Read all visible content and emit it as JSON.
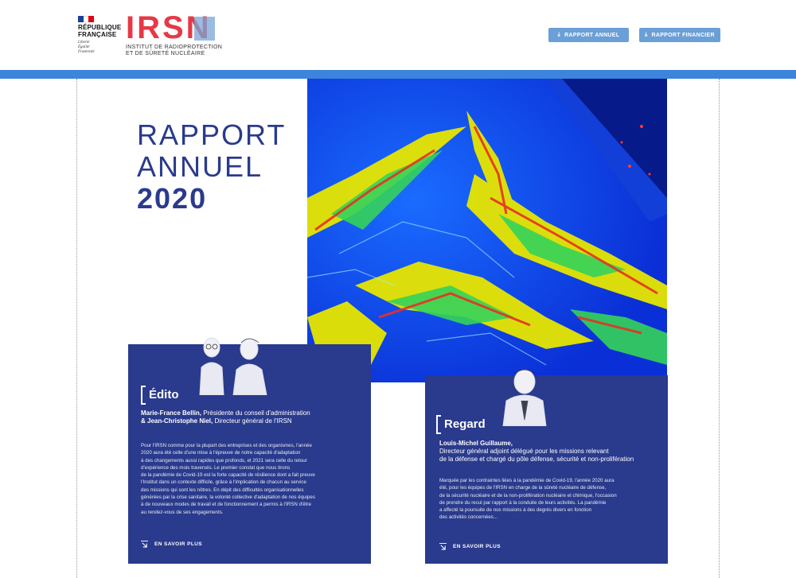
{
  "header": {
    "gov": {
      "line1": "RÉPUBLIQUE",
      "line2": "FRANÇAISE",
      "motto1": "Liberté",
      "motto2": "Égalité",
      "motto3": "Fraternité"
    },
    "logo": {
      "word": "IRSN",
      "sub1": "INSTITUT DE RADIOPROTECTION",
      "sub2": "ET DE SÛRETÉ NUCLÉAIRE"
    },
    "buttons": [
      {
        "label": "RAPPORT ANNUEL",
        "icon": "download-icon"
      },
      {
        "label": "RAPPORT FINANCIER",
        "icon": "download-icon"
      }
    ]
  },
  "colors": {
    "brand_blue": "#2a3a8c",
    "band_blue": "#3c84dc",
    "button_blue": "#6a9fd8",
    "logo_red": "#e63946"
  },
  "title": {
    "line1": "RAPPORT",
    "line2": "ANNUEL",
    "line3": "2020"
  },
  "edito": {
    "heading": "Édito",
    "author1_name": "Marie-France Bellin,",
    "author1_role": " Présidente du conseil d'administration",
    "author2_name": "& Jean-Christophe Niel,",
    "author2_role": " Directeur général de l'IRSN",
    "body": [
      "Pour l'IRSN comme pour la plupart des entreprises et des organismes, l'année",
      "2020 aura été celle d'une mise à l'épreuve de notre capacité d'adaptation",
      "à des changements aussi rapides que profonds, et 2021 sera celle du retour",
      "d'expérience des mois traversés. Le premier constat que nous tirons",
      "de la pandémie de Covid-19 est la forte capacité de résilience dont a fait preuve",
      "l'Institut dans un contexte difficile, grâce à l'implication de chacun au service",
      "des missions qui sont les nôtres. En dépit des difficultés organisationnelles",
      "générées par la crise sanitaire, la volonté collective d'adaptation de nos équipes",
      "à de nouveaux modes de travail et de fonctionnement a permis à l'IRSN d'être",
      "au rendez-vous de ses engagements."
    ],
    "link": "EN SAVOIR PLUS"
  },
  "regard": {
    "heading": "Regard",
    "author_name": "Louis-Michel Guillaume,",
    "author_role_line1": "Directeur général adjoint délégué pour les missions relevant",
    "author_role_line2": "de la défense et chargé du pôle défense, sécurité et non-prolifération",
    "body": [
      "Marquée par les contraintes liées à la pandémie de Covid-19, l'année 2020 aura",
      "été, pour les équipes de l'IRSN en charge de la sûreté nucléaire de défense,",
      "de la sécurité nucléaire et de la non-prolifération nucléaire et chimique, l'occasion",
      "de prendre du recul par rapport à la conduite de leurs activités. La pandémie",
      "a affecté la poursuite de nos missions à des degrés divers en fonction",
      "des activités concernées..."
    ],
    "link": "EN SAVOIR PLUS"
  }
}
